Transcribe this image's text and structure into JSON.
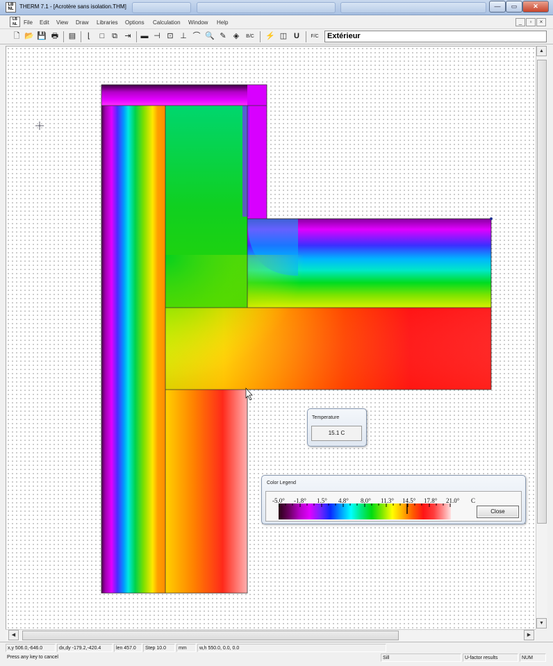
{
  "window": {
    "title": "THERM 7.1 - [Acrotère sans isolation.THM]",
    "app_icon_text": "LBNL THERM",
    "caption_buttons": {
      "minimize": "—",
      "maximize": "▭",
      "close": "✕"
    }
  },
  "menu": {
    "items": [
      "File",
      "Edit",
      "View",
      "Draw",
      "Libraries",
      "Options",
      "Calculation",
      "Window",
      "Help"
    ],
    "mdi_buttons": [
      "_",
      "▫",
      "×"
    ]
  },
  "toolbar": {
    "material_field_value": "Extérieur",
    "b_c_tool_label": "B/C",
    "u_tool_label": "U",
    "fc_tool_label": "F/C"
  },
  "temperature_popup": {
    "title": "Temperature",
    "value": "15.1 C"
  },
  "color_legend": {
    "title": "Color Legend",
    "ticks": [
      "-5.0°",
      "-1.8°",
      "1.5°",
      "4.8°",
      "8.0°",
      "11.3°",
      "14.5°",
      "17.8°",
      "21.0°"
    ],
    "unit": "C",
    "close_label": "Close",
    "min": -5.0,
    "max": 21.0
  },
  "status": {
    "xy": "x,y  506.0,-646.0",
    "dxdy": "dx,dy  -179.2,-420.4",
    "len": "len  457.0",
    "step": "Step  10.0",
    "unit": "mm",
    "wh": "w,h  550.0,   0.0,    0.0",
    "prompt": "Press any key to cancel",
    "boundary": "Sill",
    "results": "U-factor results",
    "num": "NUM"
  },
  "colors": {
    "window_frame": "#a9c1e3",
    "close_button": "#c9452b",
    "dialog_bg": "#dfe7f1"
  }
}
